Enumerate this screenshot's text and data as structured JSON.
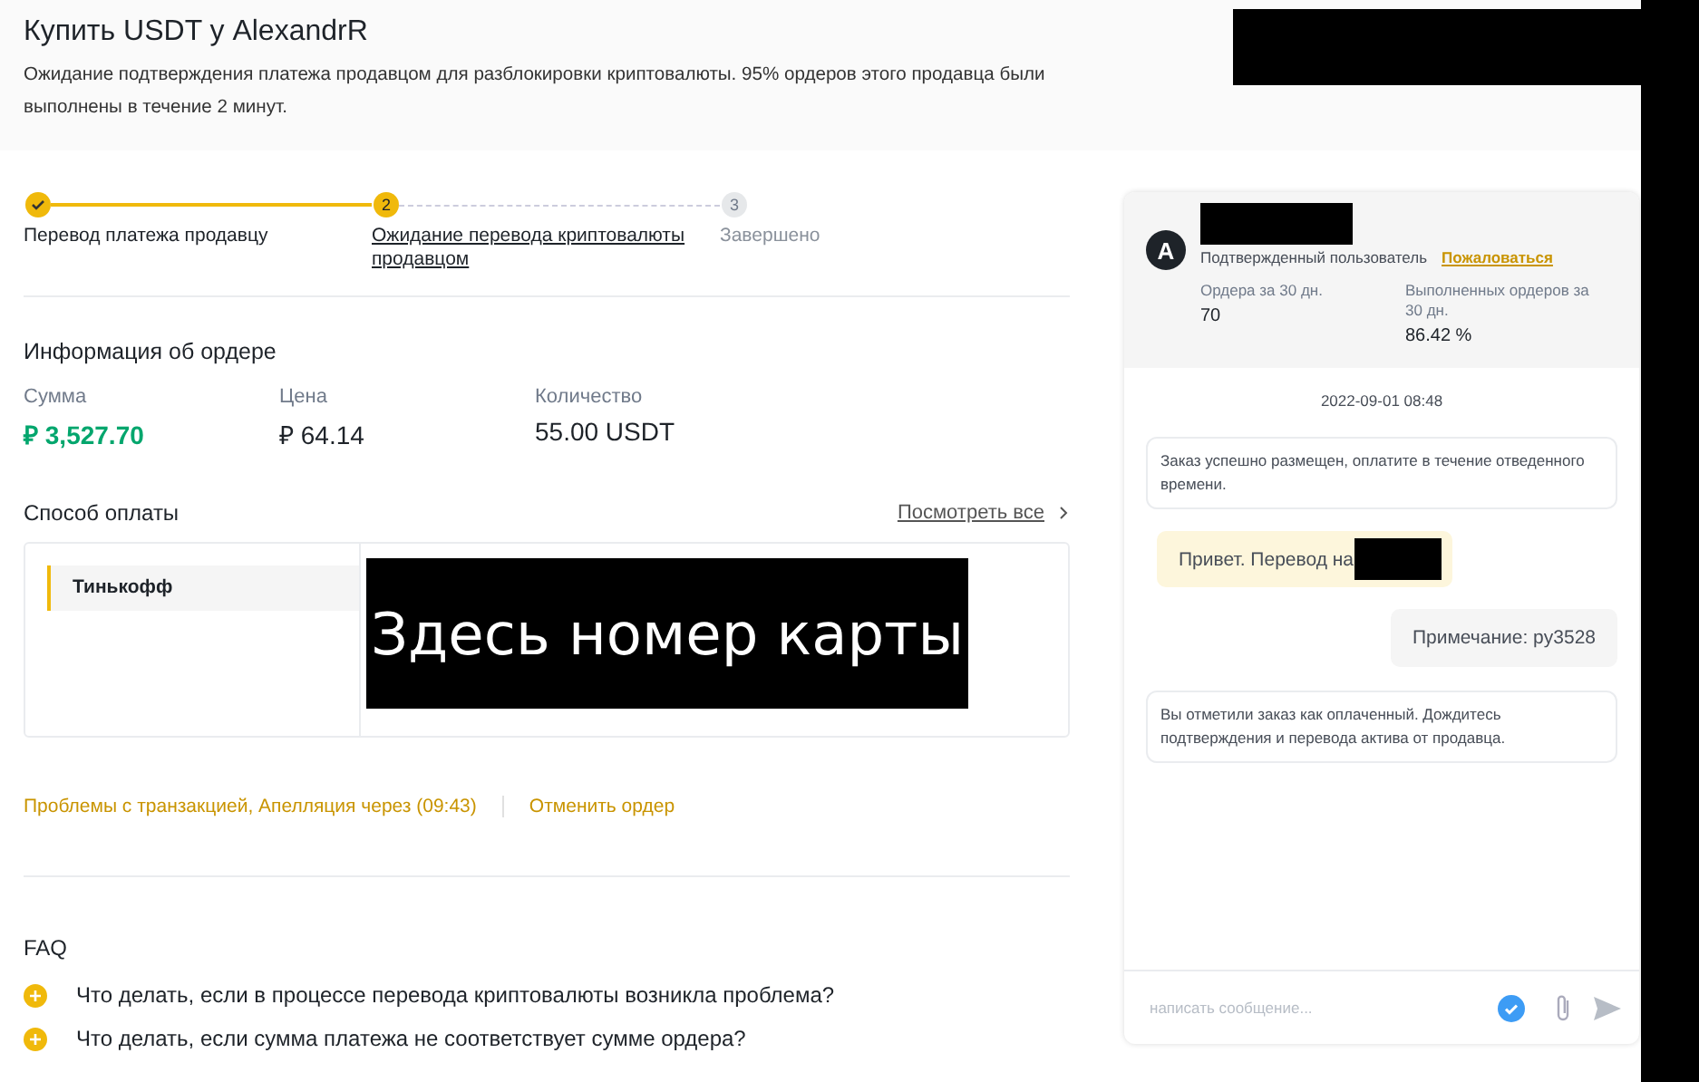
{
  "header": {
    "title": "Купить USDT у AlexandrR",
    "subtitle": "Ожидание подтверждения платежа продавцом для разблокировки криптовалюты. 95% ордеров этого продавца были выполнены в течение 2 минут."
  },
  "steps": [
    {
      "label": "Перевод платежа продавцу",
      "done": true,
      "selected": false
    },
    {
      "number": "2",
      "label": "Ожидание перевода криптовалюты продавцом",
      "done": false,
      "selected": true
    },
    {
      "number": "3",
      "label": "Завершено",
      "done": false,
      "selected": false
    }
  ],
  "order_info": {
    "title": "Информация об ордере",
    "fields": [
      {
        "label": "Сумма",
        "value": "₽ 3,527.70",
        "kind": "highlight"
      },
      {
        "label": "Цена",
        "value": "₽ 64.14",
        "kind": "plain"
      },
      {
        "label": "Количество",
        "value": "55.00 USDT",
        "kind": "plain"
      }
    ]
  },
  "payment": {
    "title": "Способ оплаты",
    "view_all": "Посмотреть все",
    "method": "Тинькофф",
    "card_note": "Здесь номер карты"
  },
  "actions": {
    "appeal": "Проблемы с транзакцией, Апелляция через (09:43)",
    "cancel": "Отменить ордер"
  },
  "faq": {
    "title": "FAQ",
    "items": [
      "Что делать, если в процессе перевода криптовалюты возникла проблема?",
      "Что делать, если сумма платежа не соответствует сумме ордера?"
    ]
  },
  "chat": {
    "avatar": "A",
    "verified": "Подтвержденный пользователь",
    "report": "Пожаловаться",
    "stats": [
      {
        "label": "Ордера за 30 дн.",
        "value": "70"
      },
      {
        "label": "Выполненных ордеров за 30 дн.",
        "value": "86.42 %"
      }
    ],
    "date": "2022-09-01 08:48",
    "messages": [
      {
        "kind": "system",
        "text": "Заказ успешно размещен, оплатите в течение отведенного времени."
      },
      {
        "kind": "incoming",
        "text": "Привет. Перевод на",
        "redacted": true
      },
      {
        "kind": "outgoing",
        "text": "Примечание: py3528"
      },
      {
        "kind": "system",
        "text": "Вы отметили заказ как оплаченный. Дождитесь подтверждения и перевода актива от продавца."
      }
    ],
    "input": {
      "placeholder": "написать сообщение..."
    }
  }
}
